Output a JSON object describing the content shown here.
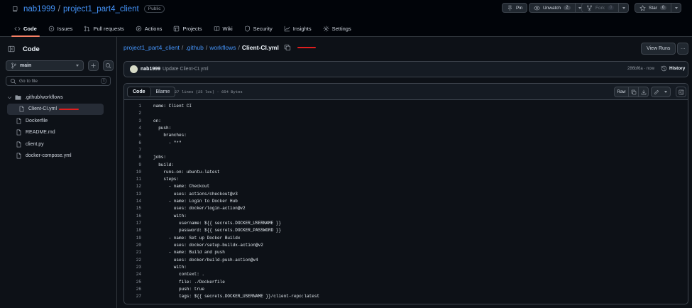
{
  "repo": {
    "owner": "nab1999",
    "separator": "/",
    "name": "project1_part4_client",
    "visibility": "Public"
  },
  "header_actions": {
    "pin_label": "Pin",
    "unwatch_label": "Unwatch",
    "unwatch_count": "2",
    "fork_label": "Fork",
    "fork_count": "0",
    "star_label": "Star",
    "star_count": "0"
  },
  "nav": {
    "tabs": [
      {
        "label": "Code",
        "icon": "code-icon",
        "active": true
      },
      {
        "label": "Issues",
        "icon": "issue-icon"
      },
      {
        "label": "Pull requests",
        "icon": "pull-request-icon"
      },
      {
        "label": "Actions",
        "icon": "play-icon"
      },
      {
        "label": "Projects",
        "icon": "table-icon"
      },
      {
        "label": "Wiki",
        "icon": "book-icon"
      },
      {
        "label": "Security",
        "icon": "shield-icon"
      },
      {
        "label": "Insights",
        "icon": "graph-icon"
      },
      {
        "label": "Settings",
        "icon": "gear-icon"
      }
    ]
  },
  "sidebar": {
    "title": "Code",
    "branch": "main",
    "goto_placeholder": "Go to file",
    "goto_shortcut": "t",
    "tree": [
      {
        "name": ".github/workflows",
        "type": "folder",
        "expanded": true
      },
      {
        "name": "Client-CI.yml",
        "type": "file",
        "selected": true
      },
      {
        "name": "Dockerfile",
        "type": "file"
      },
      {
        "name": "README.md",
        "type": "file"
      },
      {
        "name": "client.py",
        "type": "file"
      },
      {
        "name": "docker-compose.yml",
        "type": "file"
      }
    ]
  },
  "breadcrumb": {
    "root": "project1_part4_client",
    "sep": "/",
    "dir1": ".github",
    "dir2": "workflows",
    "file": "Client-CI.yml"
  },
  "view_runs_label": "View Runs",
  "commit": {
    "author": "nab1999",
    "message": "Update Client-CI.yml",
    "hash_time": "286bf6a · now",
    "history_label": "History"
  },
  "file_header": {
    "code_tab": "Code",
    "blame_tab": "Blame",
    "info": "27 lines (25 loc) · 654 Bytes",
    "raw_label": "Raw"
  },
  "code_lines": [
    "name: Client CI",
    "",
    "on:",
    "  push:",
    "    branches:",
    "      - \"*\"",
    "",
    "jobs:",
    "  build:",
    "    runs-on: ubuntu-latest",
    "    steps:",
    "      - name: Checkout",
    "        uses: actions/checkout@v3",
    "      - name: Login to Docker Hub",
    "        uses: docker/login-action@v2",
    "        with:",
    "          username: ${{ secrets.DOCKER_USERNAME }}",
    "          password: ${{ secrets.DOCKER_PASSWORD }}",
    "      - name: Set up Docker Buildx",
    "        uses: docker/setup-buildx-action@v2",
    "      - name: Build and push",
    "        uses: docker/build-push-action@v4",
    "        with:",
    "          context: .",
    "          file: ./Dockerfile",
    "          push: true",
    "          tags: ${{ secrets.DOCKER_USERNAME }}/client-repo:latest"
  ],
  "colors": {
    "accent_tab": "#f78166",
    "link": "#4493f8",
    "annotation_red": "#e01e1e",
    "background": "#0d1117"
  }
}
